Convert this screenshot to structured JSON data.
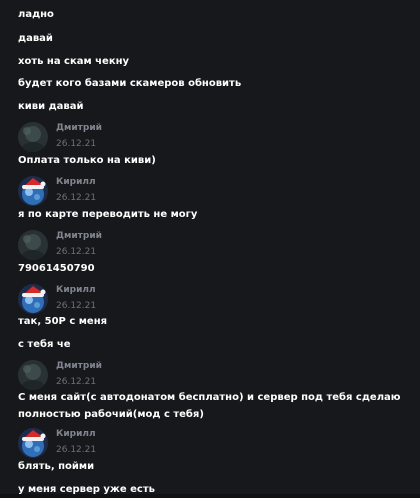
{
  "messages": [
    {
      "kind": "text",
      "text": "ладно"
    },
    {
      "kind": "text",
      "text": "давай"
    },
    {
      "kind": "text",
      "text": "хоть на скам чекну"
    },
    {
      "kind": "text",
      "text": "будет кого базами скамеров обновить"
    },
    {
      "kind": "text",
      "text": "киви давай"
    },
    {
      "kind": "author",
      "name": "Дмитрий",
      "date": "26.12.21",
      "avatar": "dark-avatar"
    },
    {
      "kind": "text",
      "text": "Оплата только на киви)"
    },
    {
      "kind": "author",
      "name": "Кирилл",
      "date": "26.12.21",
      "avatar": "santa-hat-avatar"
    },
    {
      "kind": "text",
      "text": "я по карте переводить не могу"
    },
    {
      "kind": "author",
      "name": "Дмитрий",
      "date": "26.12.21",
      "avatar": "dark-avatar"
    },
    {
      "kind": "text",
      "text": "79061450790"
    },
    {
      "kind": "author",
      "name": "Кирилл",
      "date": "26.12.21",
      "avatar": "santa-hat-avatar"
    },
    {
      "kind": "text",
      "text": "так, 50Р с меня"
    },
    {
      "kind": "text",
      "text": "с тебя че"
    },
    {
      "kind": "author",
      "name": "Дмитрий",
      "date": "26.12.21",
      "avatar": "dark-avatar"
    },
    {
      "kind": "text",
      "text": "С меня сайт(с автодонатом бесплатно) и сервер под тебя сделаю полностью рабочий(мод с тебя)"
    },
    {
      "kind": "author",
      "name": "Кирилл",
      "date": "26.12.21",
      "avatar": "santa-hat-avatar"
    },
    {
      "kind": "text",
      "text": "блять, пойми"
    },
    {
      "kind": "text",
      "text": "у меня сервер уже есть"
    }
  ],
  "colors": {
    "background": "#17181b",
    "text": "#ffffff",
    "author": "#808590",
    "date": "#6d7079"
  }
}
